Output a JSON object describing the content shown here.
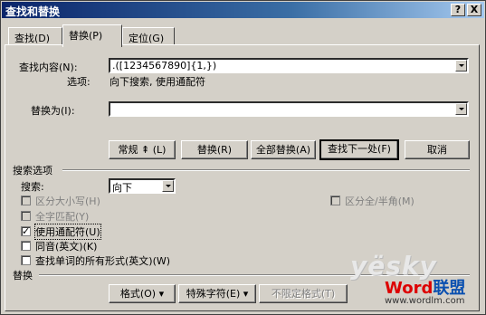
{
  "window": {
    "title": "查找和替换",
    "help_glyph": "?",
    "close_glyph": "X"
  },
  "tabs": [
    {
      "label": "查找",
      "key": "(D)"
    },
    {
      "label": "替换",
      "key": "(P)"
    },
    {
      "label": "定位",
      "key": "(G)"
    }
  ],
  "find": {
    "label": "查找内容",
    "key": "(N)",
    "value": ".([1234567890]{1,})",
    "options_label": "选项:",
    "options_value": "向下搜索, 使用通配符"
  },
  "replace": {
    "label": "替换为",
    "key": "(I)",
    "value": ""
  },
  "buttons": {
    "less": "常规 ⇞ (L)",
    "replace": "替换(R)",
    "replace_all": "全部替换(A)",
    "find_next": "查找下一处(F)",
    "cancel": "取消"
  },
  "search_options": {
    "header": "搜索选项",
    "search_label": "搜索:",
    "search_value": "向下",
    "match_case": "区分大小写(H)",
    "whole_word": "全字匹配(Y)",
    "wildcards": "使用通配符(U)",
    "sounds_like": "同音(英文)(K)",
    "all_forms": "查找单词的所有形式(英文)(W)",
    "width": "区分全/半角(M)"
  },
  "replace_section": {
    "header": "替换",
    "format": "格式(O) ▾",
    "special": "特殊字符(E) ▾",
    "no_format": "不限定格式(T)"
  },
  "watermark": {
    "brand": "yësky",
    "word": "Word",
    "lianmeng": "联盟",
    "url": "www.wordlm.com"
  }
}
